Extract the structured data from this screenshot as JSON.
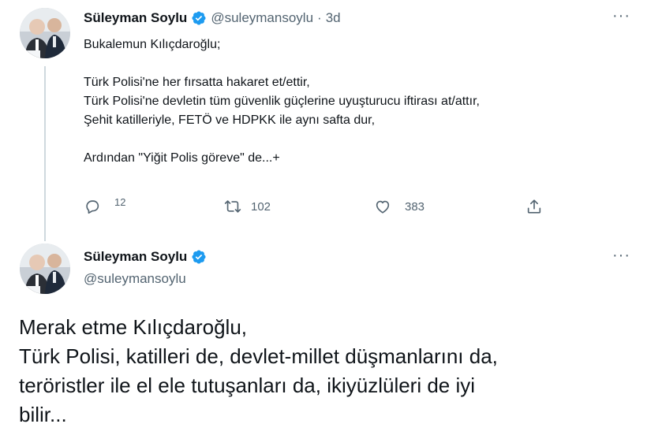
{
  "tweet1": {
    "name": "Süleyman Soylu",
    "handle": "@suleymansoylu",
    "separator": "·",
    "time": "3d",
    "text": "Bukalemun Kılıçdaroğlu;\n\nTürk Polisi'ne her fırsatta hakaret et/ettir,\nTürk Polisi'ne devletin tüm güvenlik güçlerine uyuşturucu iftirası at/attır,\nŞehit katilleriyle, FETÖ ve HDPKK ile aynı safta dur,\n\nArdından \"Yiğit Polis göreve\" de...+",
    "actions": {
      "replies": "12",
      "retweets": "102",
      "likes": "383"
    }
  },
  "tweet2": {
    "name": "Süleyman Soylu",
    "handle": "@suleymansoylu",
    "text": "Merak etme Kılıçdaroğlu,\nTürk Polisi, katilleri de, devlet-millet düşmanlarını da,\nteröristler ile el ele tutuşanları da, ikiyüzlüleri de iyi\nbilir..."
  },
  "more_label": "···",
  "colors": {
    "verified": "#1d9bf0",
    "text": "#0f1419",
    "secondary": "#536471",
    "thread_line": "#cfd9de"
  },
  "icons": [
    "verified-badge-icon",
    "reply-icon",
    "retweet-icon",
    "like-icon",
    "share-icon",
    "more-icon"
  ]
}
